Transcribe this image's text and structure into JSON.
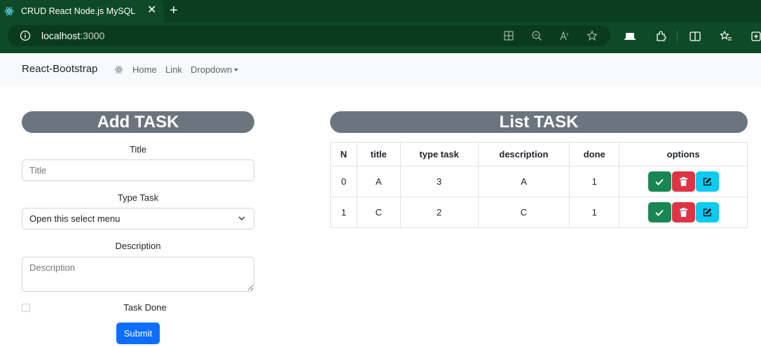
{
  "browser": {
    "tab_title": "CRUD React Node.js MySQL",
    "tab_close": "✕",
    "new_tab": "+",
    "url_host": "localhost",
    "url_port": ":3000"
  },
  "navbar": {
    "brand": "React-Bootstrap",
    "links": [
      "Home",
      "Link",
      "Dropdown"
    ]
  },
  "add_task": {
    "heading": "Add TASK",
    "title_label": "Title",
    "title_placeholder": "Title",
    "type_label": "Type Task",
    "type_selected": "Open this select menu",
    "description_label": "Description",
    "description_placeholder": "Description",
    "done_label": "Task Done",
    "submit_label": "Submit"
  },
  "list_task": {
    "heading": "List TASK",
    "columns": [
      "N",
      "title",
      "type task",
      "description",
      "done",
      "options"
    ],
    "rows": [
      [
        "0",
        "A",
        "3",
        "A",
        "1"
      ],
      [
        "1",
        "C",
        "2",
        "C",
        "1"
      ]
    ]
  },
  "colors": {
    "primary": "#0d6efd",
    "success": "#198754",
    "danger": "#dc3545",
    "info": "#0dcaf0",
    "secondary": "#6c757d"
  },
  "icons": {
    "row_actions": [
      "check-icon",
      "trash-icon",
      "edit-icon"
    ]
  }
}
